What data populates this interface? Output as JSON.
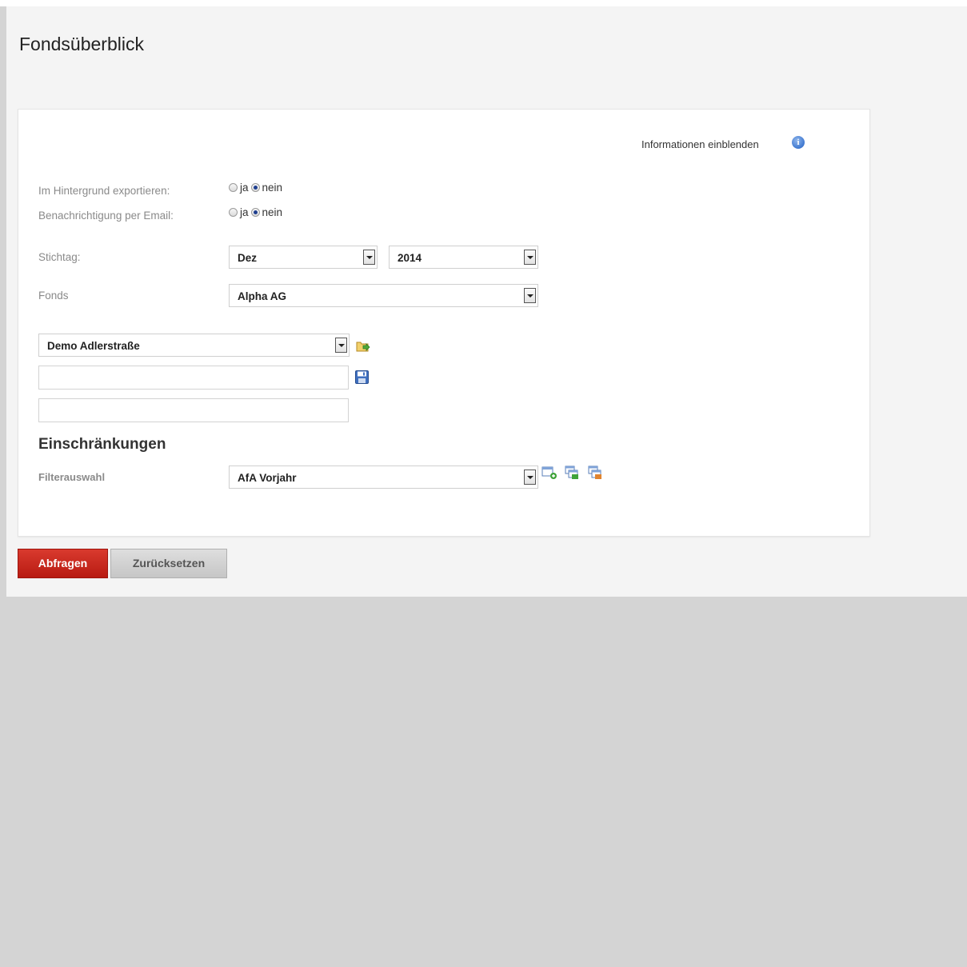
{
  "page": {
    "title": "Fondsüberblick"
  },
  "info": {
    "label": "Informationen einblenden",
    "icon": "info-icon"
  },
  "export_background": {
    "label": "Im Hintergrund exportieren:",
    "options": [
      "ja",
      "nein"
    ],
    "selected": "nein"
  },
  "email_notification": {
    "label": "Benachrichtigung per Email:",
    "options": [
      "ja",
      "nein"
    ],
    "selected": "nein"
  },
  "stichtag": {
    "label": "Stichtag:",
    "month": "Dez",
    "year": "2014"
  },
  "fonds": {
    "label": "Fonds",
    "value": "Alpha AG"
  },
  "preset": {
    "value": "Demo Adlerstraße",
    "name_field": "",
    "description_field": ""
  },
  "restrictions": {
    "title": "Einschränkungen",
    "filter_label": "Filterauswahl",
    "filter_value": "AfA Vorjahr"
  },
  "actions": {
    "submit": "Abfragen",
    "reset": "Zurücksetzen"
  }
}
